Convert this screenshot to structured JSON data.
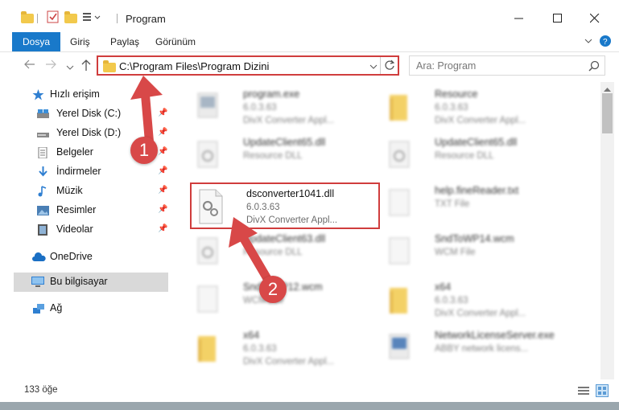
{
  "window": {
    "title": "Program"
  },
  "ribbon": {
    "tabs": [
      "Dosya",
      "Giriş",
      "Paylaş",
      "Görünüm"
    ]
  },
  "nav": {
    "address": "C:\\Program Files\\Program Dizini",
    "search_placeholder": "Ara: Program"
  },
  "sidebar": {
    "items": [
      {
        "label": "Hızlı erişim",
        "icon": "star-icon"
      },
      {
        "label": "Yerel Disk (C:)",
        "icon": "drive-icon",
        "pinned": true
      },
      {
        "label": "Yerel Disk (D:)",
        "icon": "drive-icon",
        "pinned": true
      },
      {
        "label": "Belgeler",
        "icon": "document-icon",
        "pinned": true
      },
      {
        "label": "İndirmeler",
        "icon": "download-arrow-icon",
        "pinned": true
      },
      {
        "label": "Müzik",
        "icon": "music-note-icon",
        "pinned": true
      },
      {
        "label": "Resimler",
        "icon": "pictures-icon",
        "pinned": true
      },
      {
        "label": "Videolar",
        "icon": "video-icon",
        "pinned": true
      },
      {
        "label": "OneDrive",
        "icon": "cloud-icon"
      },
      {
        "label": "Bu bilgisayar",
        "icon": "computer-icon",
        "selected": true
      },
      {
        "label": "Ağ",
        "icon": "network-icon"
      }
    ]
  },
  "files": [
    {
      "name": "program.exe",
      "l2": "6.0.3.63",
      "l3": "DivX Converter Appl...",
      "kind": "exe"
    },
    {
      "name": "Resource",
      "l2": "6.0.3.63",
      "l3": "DivX Converter Appl...",
      "kind": "folder"
    },
    {
      "name": "UpdateClient65.dll",
      "l2": "Resource DLL",
      "l3": "",
      "kind": "dll"
    },
    {
      "name": "UpdateClient65.dll",
      "l2": "Resource DLL",
      "l3": "",
      "kind": "dll"
    },
    {
      "name": "dsconverter1041.dll",
      "l2": "6.0.3.63",
      "l3": "DivX Converter Appl...",
      "kind": "dll",
      "highlighted": true
    },
    {
      "name": "help.fineReader.txt",
      "l2": "TXT File",
      "l3": "",
      "kind": "txt"
    },
    {
      "name": "UpdateClient63.dll",
      "l2": "Resource DLL",
      "l3": "",
      "kind": "dll"
    },
    {
      "name": "SndToWP14.wcm",
      "l2": "WCM File",
      "l3": "",
      "kind": "doc"
    },
    {
      "name": "SndToWP12.wcm",
      "l2": "WCM File",
      "l3": "",
      "kind": "doc"
    },
    {
      "name": "x64",
      "l2": "6.0.3.63",
      "l3": "DivX Converter Appl...",
      "kind": "folder"
    },
    {
      "name": "x64",
      "l2": "6.0.3.63",
      "l3": "DivX Converter Appl...",
      "kind": "folder"
    },
    {
      "name": "NetworkLicenseServer.exe",
      "l2": "ABBY network licens...",
      "l3": "",
      "kind": "exe"
    }
  ],
  "status": {
    "count": "133 öğe"
  },
  "annotations": {
    "badge1": "1",
    "badge2": "2"
  },
  "colors": {
    "accent": "#1979ca",
    "annotation_red": "#d84848"
  }
}
